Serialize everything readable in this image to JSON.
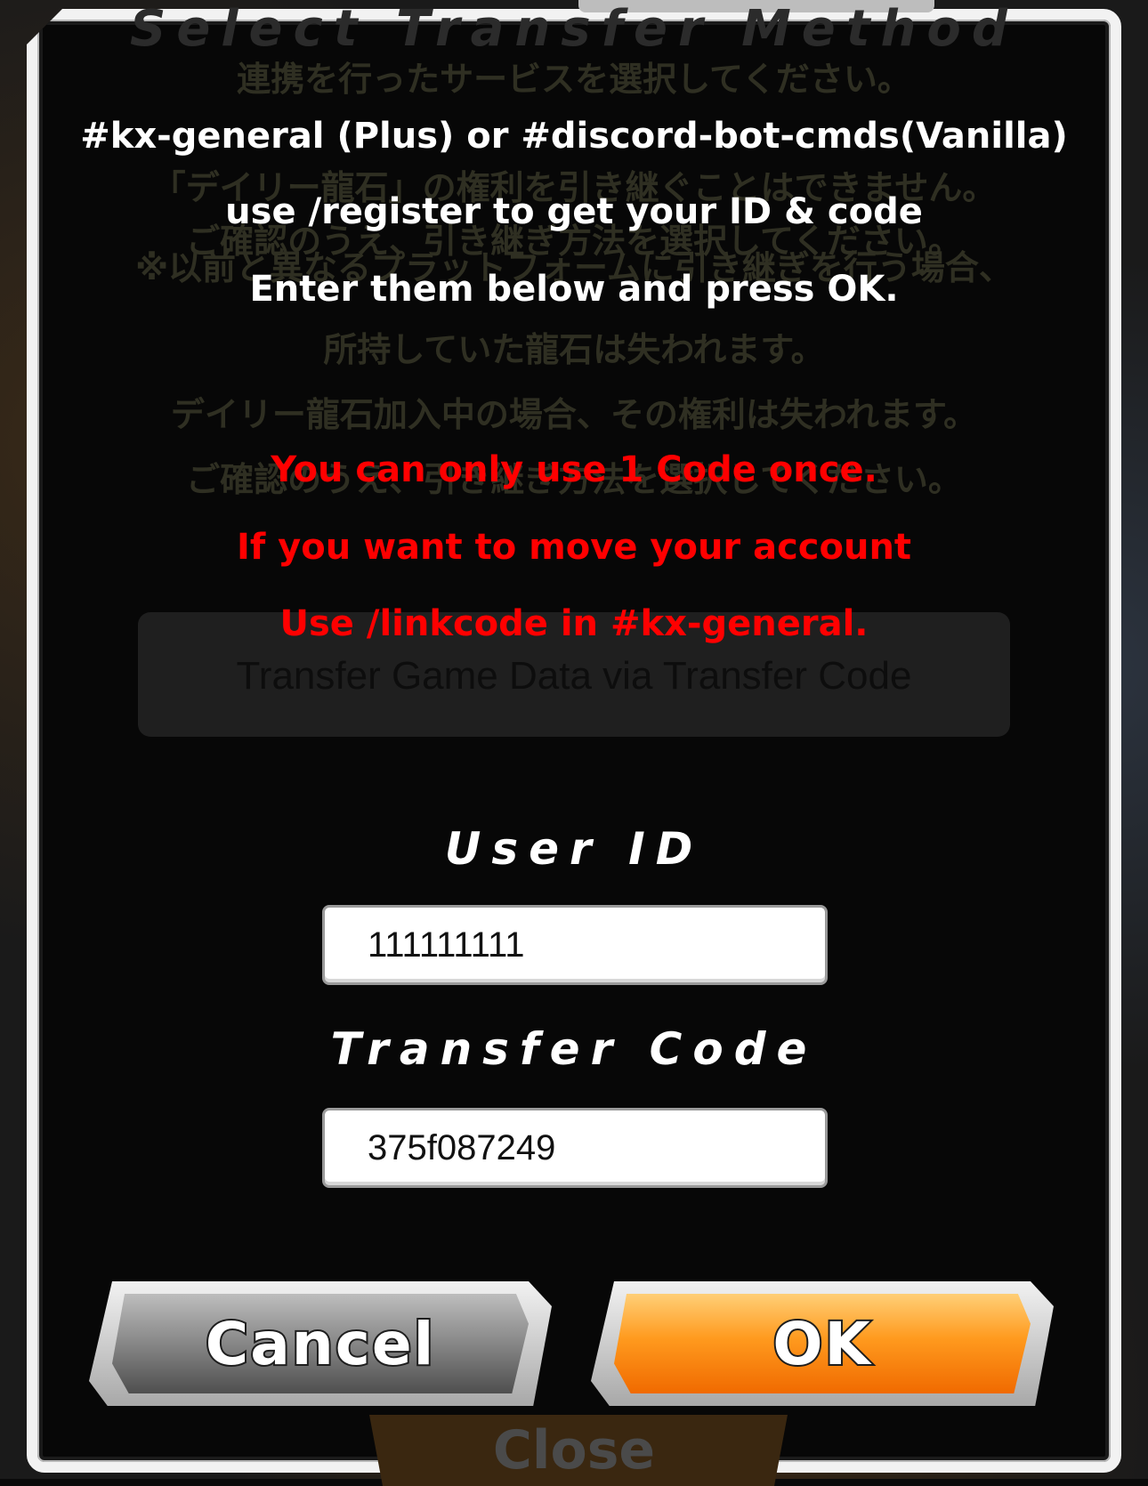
{
  "background": {
    "title": "Select Transfer Method",
    "jp_lines": [
      "連携を行ったサービスを選択してください。",
      "「デイリー龍石」の権利を引き継ぐことはできません。",
      "ご確認のうえ、引き継ぎ方法を選択してください。",
      "※以前と異なるプラットフォームに引き継ぎを行う場合、",
      "所持していた龍石は失われます。",
      "デイリー龍石加入中の場合、その権利は失われます。",
      "ご確認のうえ、引き継ぎ方法を選択してください。"
    ],
    "transfer_option": "Transfer Game Data via Transfer Code",
    "close_label": "Close"
  },
  "instructions": {
    "line1": "#kx-general (Plus) or #discord-bot-cmds(Vanilla)",
    "line2": "use /register to get your ID & code",
    "line3": "Enter them below and press OK.",
    "warning1": "You can only use 1 Code once.",
    "warning2": "If you want to move your account",
    "warning3": "Use /linkcode in #kx-general."
  },
  "form": {
    "user_id_label": "User ID",
    "user_id_value": "111111111",
    "transfer_code_label": "Transfer Code",
    "transfer_code_value": "375f087249"
  },
  "buttons": {
    "cancel": "Cancel",
    "ok": "OK"
  },
  "colors": {
    "warning": "#ff0000",
    "ok_button": "#ff9a1e",
    "cancel_button": "#8c8c8c"
  }
}
